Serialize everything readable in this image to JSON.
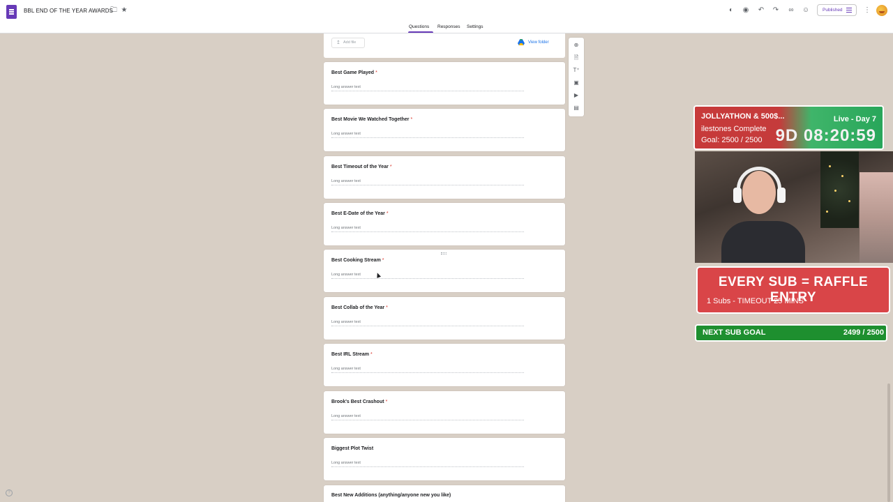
{
  "header": {
    "doc_title": "BBL END OF THE YEAR AWARDS",
    "published_label": "Published"
  },
  "tabs": [
    {
      "label": "Questions",
      "active": true
    },
    {
      "label": "Responses",
      "active": false
    },
    {
      "label": "Settings",
      "active": false
    }
  ],
  "upload": {
    "add_file_label": "Add file",
    "view_folder_label": "View folder"
  },
  "questions": [
    {
      "title": "Best Game Played",
      "required": "*",
      "hint": "Long answer text"
    },
    {
      "title": "Best Movie We Watched Together",
      "required": "*",
      "hint": "Long answer text"
    },
    {
      "title": "Best Timeout of the Year",
      "required": "*",
      "hint": "Long answer text"
    },
    {
      "title": "Best E-Date of the Year",
      "required": "*",
      "hint": "Long answer text"
    },
    {
      "title": "Best Cooking Stream",
      "required": "*",
      "hint": "Long answer text"
    },
    {
      "title": "Best Collab of the Year",
      "required": "*",
      "hint": "Long answer text"
    },
    {
      "title": "Best IRL Stream",
      "required": "*",
      "hint": "Long answer text"
    },
    {
      "title": "Brook's Best Crashout",
      "required": "*",
      "hint": "Long answer text"
    },
    {
      "title": "Biggest Plot Twist",
      "required": "",
      "hint": "Long answer text"
    },
    {
      "title": "Best New Additions (anything/anyone new you like)",
      "required": "",
      "hint": ""
    }
  ],
  "overlay": {
    "event_line": "JOLLYATHON & 500$...",
    "milestones_line": "ilestones Complete",
    "goal_line": "Goal: 2500 / 2500",
    "live_label": "Live - Day 7",
    "timer": "9D 08:20:59",
    "raffle_title": "EVERY SUB = RAFFLE ENTRY",
    "raffle_sub": "1 Subs - TIMEOUT 25 MINS",
    "next_goal_label": "NEXT SUB GOAL",
    "next_goal_value": "2499 / 2500"
  },
  "colors": {
    "forms_purple": "#673ab7",
    "background": "#d8cfc5",
    "required_red": "#d93025",
    "link_blue": "#1a73e8"
  }
}
